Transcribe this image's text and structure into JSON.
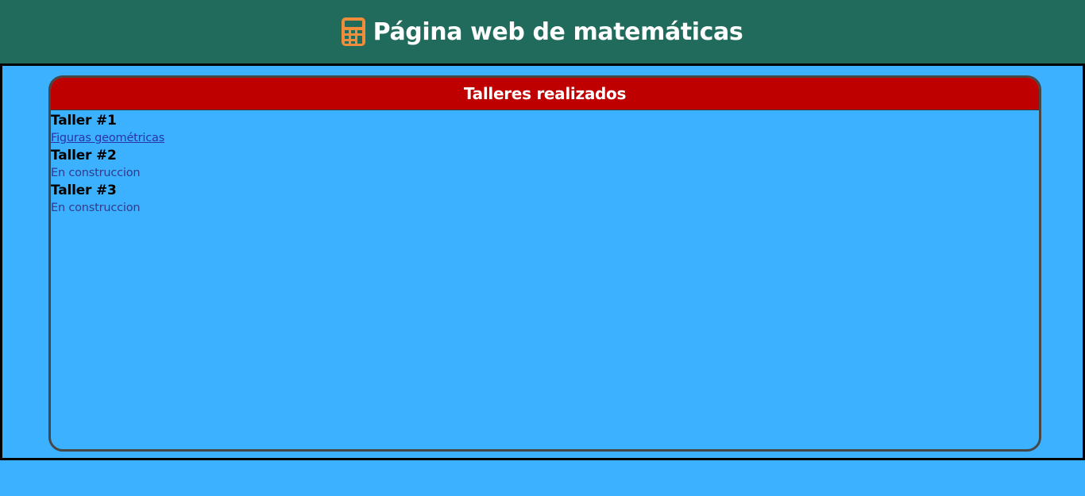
{
  "header": {
    "icon": "calculator-icon",
    "icon_color": "#ef8d3a",
    "title": "Página web de matemáticas",
    "background": "#216b5c"
  },
  "panel": {
    "title": "Talleres realizados",
    "header_color": "#bf0000",
    "workshops": [
      {
        "name": "Taller #1",
        "link_text": "Figuras geométricas"
      },
      {
        "name": "Taller #2",
        "status": "En construccion"
      },
      {
        "name": "Taller #3",
        "status": "En construccion"
      }
    ]
  },
  "page": {
    "background": "#3cb1ff"
  }
}
